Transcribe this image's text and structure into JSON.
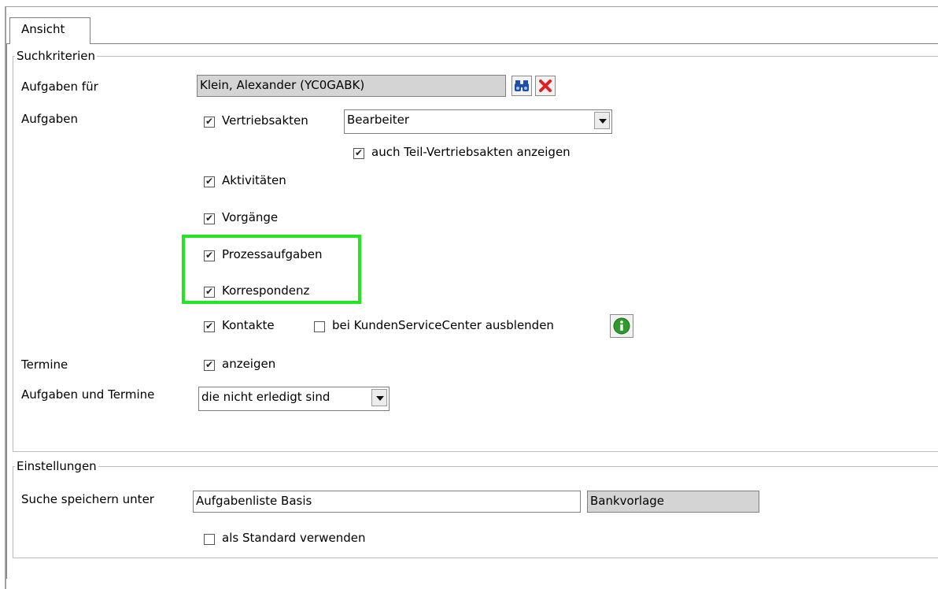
{
  "tab": {
    "label": "Ansicht"
  },
  "suchkriterien": {
    "legend": "Suchkriterien",
    "aufgaben_fuer": {
      "label": "Aufgaben für",
      "value": "Klein, Alexander (YC0GABK)"
    },
    "aufgaben": {
      "label": "Aufgaben",
      "vertriebsakten": {
        "label": "Vertriebsakten",
        "checked": true,
        "select_value": "Bearbeiter"
      },
      "teil_vertriebsakten": {
        "label": "auch Teil-Vertriebsakten anzeigen",
        "checked": true
      },
      "aktivitaeten": {
        "label": "Aktivitäten",
        "checked": true
      },
      "vorgaenge": {
        "label": "Vorgänge",
        "checked": true
      },
      "prozessaufgaben": {
        "label": "Prozessaufgaben",
        "checked": true
      },
      "korrespondenz": {
        "label": "Korrespondenz",
        "checked": true
      },
      "kontakte": {
        "label": "Kontakte",
        "checked": true
      },
      "ksc_ausblenden": {
        "label": "bei KundenServiceCenter ausblenden",
        "checked": false
      }
    },
    "termine": {
      "label": "Termine",
      "anzeigen": {
        "label": "anzeigen",
        "checked": true
      }
    },
    "aufgaben_und_termine": {
      "label": "Aufgaben und Termine",
      "select_value": "die nicht erledigt sind"
    }
  },
  "einstellungen": {
    "legend": "Einstellungen",
    "suche_speichern": {
      "label": "Suche speichern unter",
      "value": "Aufgabenliste Basis",
      "vorlage": "Bankvorlage"
    },
    "als_standard": {
      "label": "als Standard verwenden",
      "checked": false
    }
  },
  "check_mark": "✔",
  "colors": {
    "highlight": "#22e622",
    "readonly_bg": "#d4d4d4",
    "delete_red": "#e02020",
    "info_green": "#2e9a2e",
    "binoculars_blue": "#1f4fa8"
  }
}
